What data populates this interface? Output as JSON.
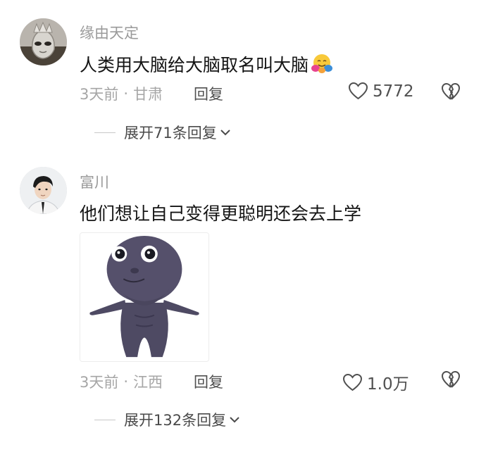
{
  "comments": [
    {
      "username": "缘由天定",
      "text": "人类用大脑给大脑取名叫大脑",
      "emoji": "hugging-face",
      "time": "3天前",
      "location": "甘肃",
      "reply_label": "回复",
      "likes": "5772",
      "expand_label": "展开71条回复"
    },
    {
      "username": "富川",
      "text": "他们想让自己变得更聪明还会去上学",
      "sticker": "dark-blob-creature",
      "time": "3天前",
      "location": "江西",
      "reply_label": "回复",
      "likes": "1.0万",
      "expand_label": "展开132条回复"
    }
  ],
  "separator": "·",
  "colors": {
    "meta": "#a6a6a6",
    "username": "#9a9a9a",
    "text": "#141414",
    "icon": "#505050"
  }
}
